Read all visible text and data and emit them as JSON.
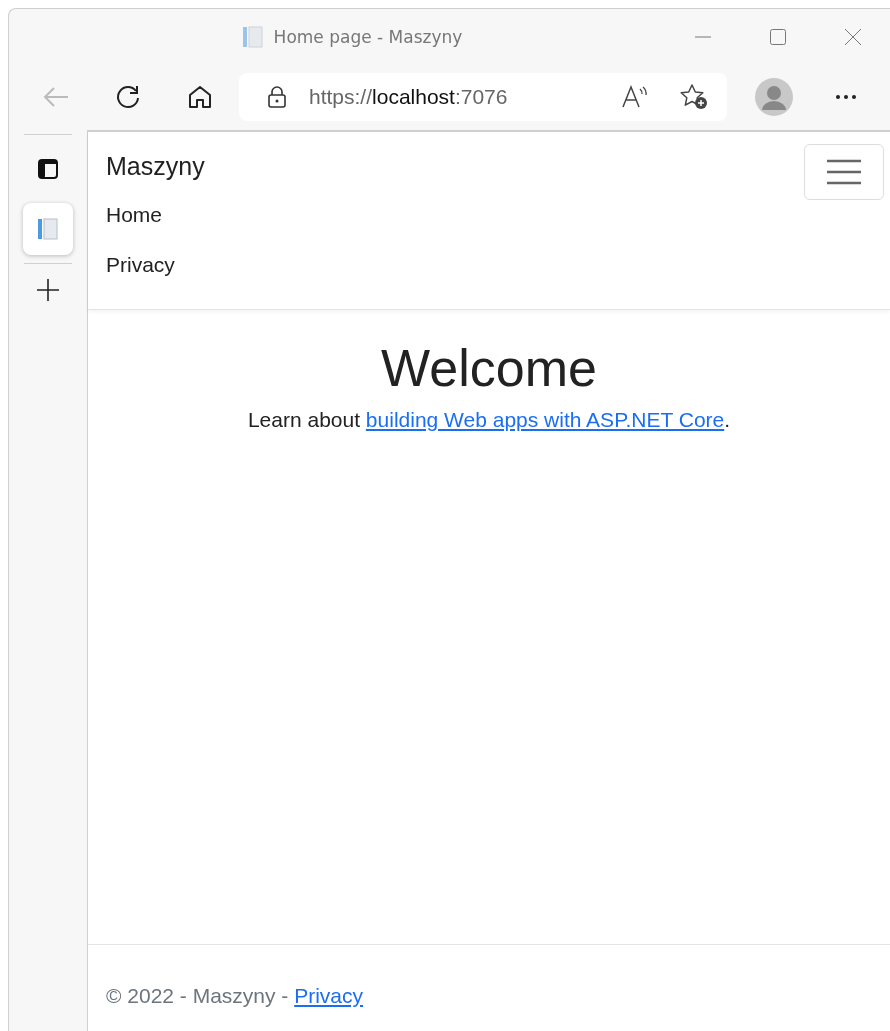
{
  "window": {
    "title": "Home page - Maszyny"
  },
  "toolbar": {
    "back_disabled": true,
    "url": {
      "scheme": "https://",
      "host": "localhost",
      "port": ":7076"
    }
  },
  "sidebar": {
    "tabs": [
      {
        "kind": "workspaces",
        "selected": false
      },
      {
        "kind": "page",
        "selected": true
      }
    ]
  },
  "navbar": {
    "brand": "Maszyny",
    "links": [
      "Home",
      "Privacy"
    ]
  },
  "main": {
    "heading": "Welcome",
    "lead_before": "Learn about ",
    "lead_link": "building Web apps with ASP.NET Core",
    "lead_after": "."
  },
  "footer": {
    "text": "© 2022 - Maszyny - ",
    "link": "Privacy"
  }
}
